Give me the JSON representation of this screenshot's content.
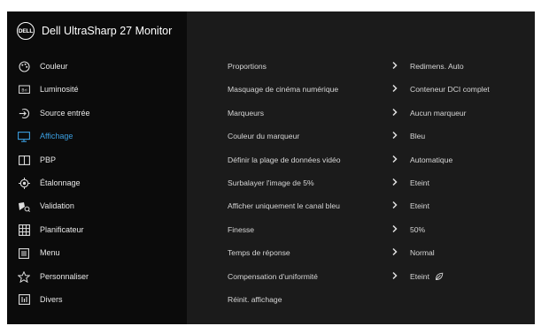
{
  "app": {
    "title": "Dell UltraSharp 27 Monitor",
    "logo_text": "DELL"
  },
  "sidebar": {
    "items": [
      {
        "label": "Couleur",
        "icon": "color-palette-icon",
        "active": false
      },
      {
        "label": "Luminosité",
        "icon": "brightness-icon",
        "active": false
      },
      {
        "label": "Source entrée",
        "icon": "input-source-icon",
        "active": false
      },
      {
        "label": "Affichage",
        "icon": "display-icon",
        "active": true
      },
      {
        "label": "PBP",
        "icon": "pbp-icon",
        "active": false
      },
      {
        "label": "Étalonnage",
        "icon": "calibration-icon",
        "active": false
      },
      {
        "label": "Validation",
        "icon": "validation-icon",
        "active": false
      },
      {
        "label": "Planificateur",
        "icon": "scheduler-icon",
        "active": false
      },
      {
        "label": "Menu",
        "icon": "menu-icon",
        "active": false
      },
      {
        "label": "Personnaliser",
        "icon": "star-icon",
        "active": false
      },
      {
        "label": "Divers",
        "icon": "others-icon",
        "active": false
      }
    ]
  },
  "settings": {
    "rows": [
      {
        "label": "Proportions",
        "value": "Redimens. Auto"
      },
      {
        "label": "Masquage de cinéma numérique",
        "value": "Conteneur DCI complet"
      },
      {
        "label": "Marqueurs",
        "value": "Aucun marqueur"
      },
      {
        "label": "Couleur du marqueur",
        "value": "Bleu"
      },
      {
        "label": "Définir la plage de données vidéo",
        "value": "Automatique"
      },
      {
        "label": "Surbalayer l'image de 5%",
        "value": "Eteint"
      },
      {
        "label": "Afficher uniquement le canal bleu",
        "value": "Eteint"
      },
      {
        "label": "Finesse",
        "value": "50%"
      },
      {
        "label": "Temps de réponse",
        "value": "Normal"
      },
      {
        "label": "Compensation d'uniformité",
        "value": "Eteint",
        "icon": "energy-leaf-icon"
      },
      {
        "label": "Réinit. affichage",
        "value": ""
      }
    ]
  },
  "colors": {
    "active": "#3a9dde",
    "panel_left": "#0b0b0b",
    "panel_right": "#1b1b1b"
  }
}
